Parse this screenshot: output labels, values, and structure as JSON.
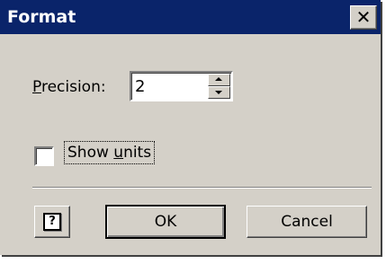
{
  "window": {
    "title": "Format",
    "close_glyph": "✕",
    "close_icon": "close-icon"
  },
  "precision": {
    "label": "Precision:",
    "value": "2",
    "spin_up_icon": "spin-up-arrow-icon",
    "spin_down_icon": "spin-down-arrow-icon"
  },
  "show_units": {
    "label": "Show units",
    "checked": false
  },
  "buttons": {
    "help_glyph": "?",
    "help_icon": "help-question-icon",
    "ok_label": "OK",
    "cancel_label": "Cancel"
  },
  "colors": {
    "titlebar": "#0a246a",
    "face": "#d4d0c8"
  }
}
